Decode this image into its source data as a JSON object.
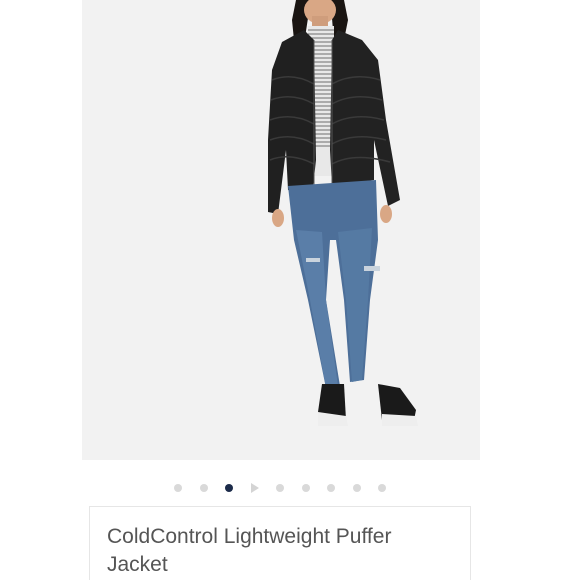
{
  "product": {
    "title": "ColdControl Lightweight Puffer Jacket",
    "image_alt": "Model wearing black puffer jacket with striped turtleneck and skinny jeans"
  },
  "carousel": {
    "total_items": 9,
    "active_index": 2,
    "video_index": 3
  },
  "colors": {
    "dot_active": "#1c2b4a",
    "dot_inactive": "#d9d9d9",
    "image_background": "#f2f2f2",
    "title_text": "#555555"
  }
}
